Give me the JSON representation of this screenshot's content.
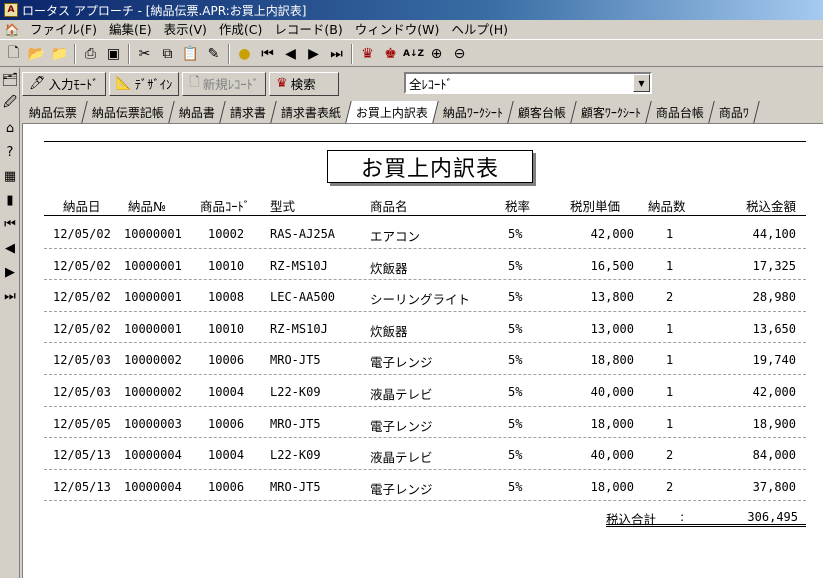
{
  "window": {
    "title": "ロータス アプローチ - [納品伝票.APR:お買上内訳表]"
  },
  "menu": [
    "ファイル(F)",
    "編集(E)",
    "表示(V)",
    "作成(C)",
    "レコード(B)",
    "ウィンドウ(W)",
    "ヘルプ(H)"
  ],
  "modebar": {
    "input_mode": "入力ﾓｰﾄﾞ",
    "design": "ﾃﾞｻﾞｲﾝ",
    "new_record": "新規ﾚｺｰﾄﾞ",
    "search": "検索",
    "record_filter": "全ﾚｺｰﾄﾞ"
  },
  "tabs": [
    "納品伝票",
    "納品伝票記帳",
    "納品書",
    "請求書",
    "請求書表紙",
    "お買上内訳表",
    "納品ﾜｰｸｼｰﾄ",
    "顧客台帳",
    "顧客ﾜｰｸｼｰﾄ",
    "商品台帳",
    "商品ﾜ"
  ],
  "active_tab": "お買上内訳表",
  "report": {
    "title": "お買上内訳表",
    "headers": {
      "date": "納品日",
      "no": "納品№",
      "code": "商品ｺｰﾄﾞ",
      "model": "型式",
      "name": "商品名",
      "tax": "税率",
      "unit": "税別単価",
      "qty": "納品数",
      "total": "税込金額"
    },
    "rows": [
      {
        "date": "12/05/02",
        "no": "10000001",
        "code": "10002",
        "model": "RAS-AJ25A",
        "name": "エアコン",
        "tax": "5%",
        "unit": "42,000",
        "qty": "1",
        "total": "44,100"
      },
      {
        "date": "12/05/02",
        "no": "10000001",
        "code": "10010",
        "model": "RZ-MS10J",
        "name": "炊飯器",
        "tax": "5%",
        "unit": "16,500",
        "qty": "1",
        "total": "17,325"
      },
      {
        "date": "12/05/02",
        "no": "10000001",
        "code": "10008",
        "model": "LEC-AA500",
        "name": "シーリングライト",
        "tax": "5%",
        "unit": "13,800",
        "qty": "2",
        "total": "28,980"
      },
      {
        "date": "12/05/02",
        "no": "10000001",
        "code": "10010",
        "model": "RZ-MS10J",
        "name": "炊飯器",
        "tax": "5%",
        "unit": "13,000",
        "qty": "1",
        "total": "13,650"
      },
      {
        "date": "12/05/03",
        "no": "10000002",
        "code": "10006",
        "model": "MRO-JT5",
        "name": "電子レンジ",
        "tax": "5%",
        "unit": "18,800",
        "qty": "1",
        "total": "19,740"
      },
      {
        "date": "12/05/03",
        "no": "10000002",
        "code": "10004",
        "model": "L22-K09",
        "name": "液晶テレビ",
        "tax": "5%",
        "unit": "40,000",
        "qty": "1",
        "total": "42,000"
      },
      {
        "date": "12/05/05",
        "no": "10000003",
        "code": "10006",
        "model": "MRO-JT5",
        "name": "電子レンジ",
        "tax": "5%",
        "unit": "18,000",
        "qty": "1",
        "total": "18,900"
      },
      {
        "date": "12/05/13",
        "no": "10000004",
        "code": "10004",
        "model": "L22-K09",
        "name": "液晶テレビ",
        "tax": "5%",
        "unit": "40,000",
        "qty": "2",
        "total": "84,000"
      },
      {
        "date": "12/05/13",
        "no": "10000004",
        "code": "10006",
        "model": "MRO-JT5",
        "name": "電子レンジ",
        "tax": "5%",
        "unit": "18,000",
        "qty": "2",
        "total": "37,800"
      }
    ],
    "total_label": "税込合計",
    "total_colon": ":",
    "total_value": "306,495"
  },
  "icons": {
    "toolbar": [
      "new-doc-icon",
      "open-folder-icon",
      "save-icon",
      "print-icon",
      "preview-icon",
      "cut-icon",
      "copy-icon",
      "paste-icon",
      "spell-icon",
      "lightbulb-icon",
      "first-record-icon",
      "prev-record-icon",
      "next-record-icon",
      "last-record-icon",
      "find-icon",
      "find-all-icon",
      "sort-icon",
      "zoom-in-icon",
      "zoom-out-icon"
    ]
  }
}
